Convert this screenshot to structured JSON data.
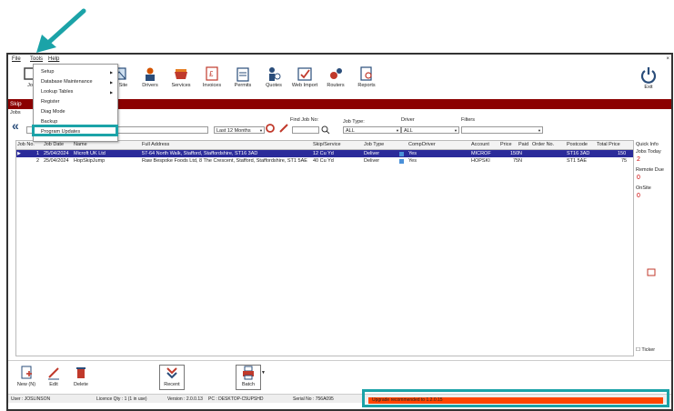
{
  "menubar": {
    "file": "File",
    "tools": "Tools",
    "help": "Help",
    "close": "×"
  },
  "toolbar": {
    "items": [
      {
        "label": "Jo"
      },
      {
        "label": "On Site"
      },
      {
        "label": "Drivers"
      },
      {
        "label": "Services"
      },
      {
        "label": "Invoices"
      },
      {
        "label": "Permits"
      },
      {
        "label": "Quotes"
      },
      {
        "label": "Web Import"
      },
      {
        "label": "Routers"
      },
      {
        "label": "Reports"
      }
    ],
    "exit": "Exit"
  },
  "tools_menu": {
    "items": [
      "Setup",
      "Database Maintenance",
      "Lookup Tables",
      "Register",
      "Diag Mode",
      "Backup",
      "Program Updates"
    ]
  },
  "redbar": {
    "title": "Skip"
  },
  "subbar": {
    "label": "Jobs"
  },
  "filters": {
    "date_range": "Last 12 Months",
    "find_job_label": "Find Job No:",
    "job_type_label": "Job Type:",
    "job_type_value": "ALL",
    "driver_label": "Driver",
    "driver_value": "ALL",
    "filters_label": "Filters",
    "filters_value": ""
  },
  "grid": {
    "headers": [
      "Job No.",
      "Job Date",
      "Name",
      "Full Address",
      "Skip/Service",
      "Job Type",
      "Comp",
      "Driver",
      "Account",
      "Price",
      "Paid",
      "Order No.",
      "Postcode",
      "Total Price"
    ],
    "rows": [
      {
        "job": "1",
        "date": "25/04/2024",
        "name": "Microft UK Ltd",
        "address": "57-64 North Walk, Stafford, Staffordshire, ST16 3AD",
        "service": "12 Cu Yd",
        "type": "Deliver",
        "comp": "Yes",
        "driver": "",
        "account": "MICROF",
        "price": "150",
        "paid": "N",
        "order": "",
        "postcode": "ST16 3AD",
        "total": "150"
      },
      {
        "job": "2",
        "date": "25/04/2024",
        "name": "HopSkipJump",
        "address": "Raw Bespoke Foods Ltd, 8 The Crescent, Stafford, Staffordshire, ST1 5AE",
        "service": "40 Cu Yd",
        "type": "Deliver",
        "comp": "Yes",
        "driver": "",
        "account": "HOPSKI",
        "price": "75",
        "paid": "N",
        "order": "",
        "postcode": "ST1 5AE",
        "total": "75"
      }
    ]
  },
  "quick": {
    "title": "Quick Info",
    "jobs_today_label": "Jobs Today",
    "jobs_today": "2",
    "remote_due_label": "Remote Due",
    "remote_due": "0",
    "onsite_label": "OnSite",
    "onsite": "0",
    "ticker": "Ticker"
  },
  "bottom": {
    "new": "New (N)",
    "edit": "Edit",
    "delete": "Delete",
    "recent": "Recent",
    "batch": "Batch"
  },
  "status": {
    "user": "User : JOSLINSON",
    "licence": "Licence Qty : 1 (1 in use)",
    "version": "Version : 2.0.0.13",
    "pc": "PC : DESKTOP-C5UPSHD",
    "serial": "Serial No : 756A095",
    "upgrade": "Upgrade recommended to 1.2.0.15"
  },
  "colors": {
    "accent": "#1ba3a8",
    "brand_red": "#8b0000",
    "alert": "#ff4500",
    "selection": "#2b2b9a"
  }
}
